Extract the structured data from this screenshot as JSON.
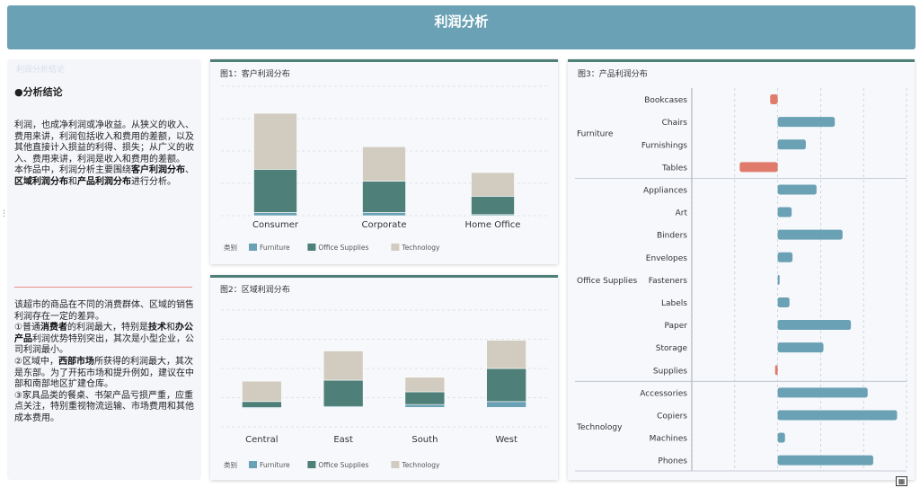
{
  "header": {
    "title": "利润分析"
  },
  "left_panel": {
    "faint_label": "利润分析结论",
    "heading": "●分析结论",
    "intro_html": "利润，也成净利润或净收益。从狭义的收入、费用来讲，利润包括收入和费用的差额，以及其他直接计入损益的利得、损失；从广义的收入、费用来讲，利润是收入和费用的差额。<br>本作品中，利润分析主要围绕<b>客户利润分布</b>、<b>区域利润分布</b>和<b>产品利润分布</b>进行分析。",
    "findings_html": "该超市的商品在不同的消费群体、区域的销售利润存在一定的差异。<br>①普通<b>消费者</b>的利润最大，特别是<b>技术</b>和<b>办公产品</b>利润优势特别突出，其次是小型企业，公司利润最小。<br>②区域中，<b>西部市场</b>所获得的利润最大，其次是东部。为了开拓市场和提升例如，建议在中部和南部地区扩建仓库。<br>③家具品类的餐桌、书架产品亏损严重，应重点关注，特别重视物流运输、市场费用和其他成本费用。"
  },
  "colors": {
    "furniture": "#6aa1b5",
    "office_supplies": "#4e7f78",
    "technology": "#d2ccc0",
    "negative": "#e07b6c"
  },
  "chart_data": [
    {
      "type": "bar",
      "stacked": true,
      "title": "图1：客户利润分布",
      "categories": [
        "Consumer",
        "Corporate",
        "Home Office"
      ],
      "legend_title": "类别",
      "legend_position": "bottom-left",
      "series": [
        {
          "name": "Furniture",
          "values": [
            3,
            3,
            1
          ]
        },
        {
          "name": "Office Supplies",
          "values": [
            40,
            29,
            17
          ]
        },
        {
          "name": "Technology",
          "values": [
            52,
            32,
            22
          ]
        }
      ],
      "ylim": [
        0,
        120
      ],
      "grid": true
    },
    {
      "type": "bar",
      "stacked": true,
      "title": "图2：区域利润分布",
      "categories": [
        "Central",
        "East",
        "South",
        "West"
      ],
      "legend_title": "类别",
      "legend_position": "bottom-left",
      "series": [
        {
          "name": "Furniture",
          "values": [
            -1,
            1,
            3,
            6
          ]
        },
        {
          "name": "Office Supplies",
          "values": [
            6,
            27,
            13,
            34
          ]
        },
        {
          "name": "Technology",
          "values": [
            21,
            30,
            15,
            29
          ]
        }
      ],
      "ylim": [
        -20,
        100
      ],
      "grid": true
    },
    {
      "type": "bar",
      "orientation": "horizontal",
      "title": "图3：产品利润分布",
      "groups": [
        {
          "name": "Furniture",
          "items": [
            {
              "label": "Bookcases",
              "value": -3.5
            },
            {
              "label": "Chairs",
              "value": 26.6
            },
            {
              "label": "Furnishings",
              "value": 13.1
            },
            {
              "label": "Tables",
              "value": -17.7
            }
          ]
        },
        {
          "name": "Office Supplies",
          "items": [
            {
              "label": "Appliances",
              "value": 18.1
            },
            {
              "label": "Art",
              "value": 6.5
            },
            {
              "label": "Binders",
              "value": 30.2
            },
            {
              "label": "Envelopes",
              "value": 6.9
            },
            {
              "label": "Fasteners",
              "value": 0.9
            },
            {
              "label": "Labels",
              "value": 5.5
            },
            {
              "label": "Paper",
              "value": 34.1
            },
            {
              "label": "Storage",
              "value": 21.3
            },
            {
              "label": "Supplies",
              "value": -1.2
            }
          ]
        },
        {
          "name": "Technology",
          "items": [
            {
              "label": "Accessories",
              "value": 41.9
            },
            {
              "label": "Copiers",
              "value": 55.6
            },
            {
              "label": "Machines",
              "value": 3.4
            },
            {
              "label": "Phones",
              "value": 44.5
            }
          ]
        }
      ],
      "xlim": [
        -40,
        60
      ],
      "grid": true
    }
  ]
}
